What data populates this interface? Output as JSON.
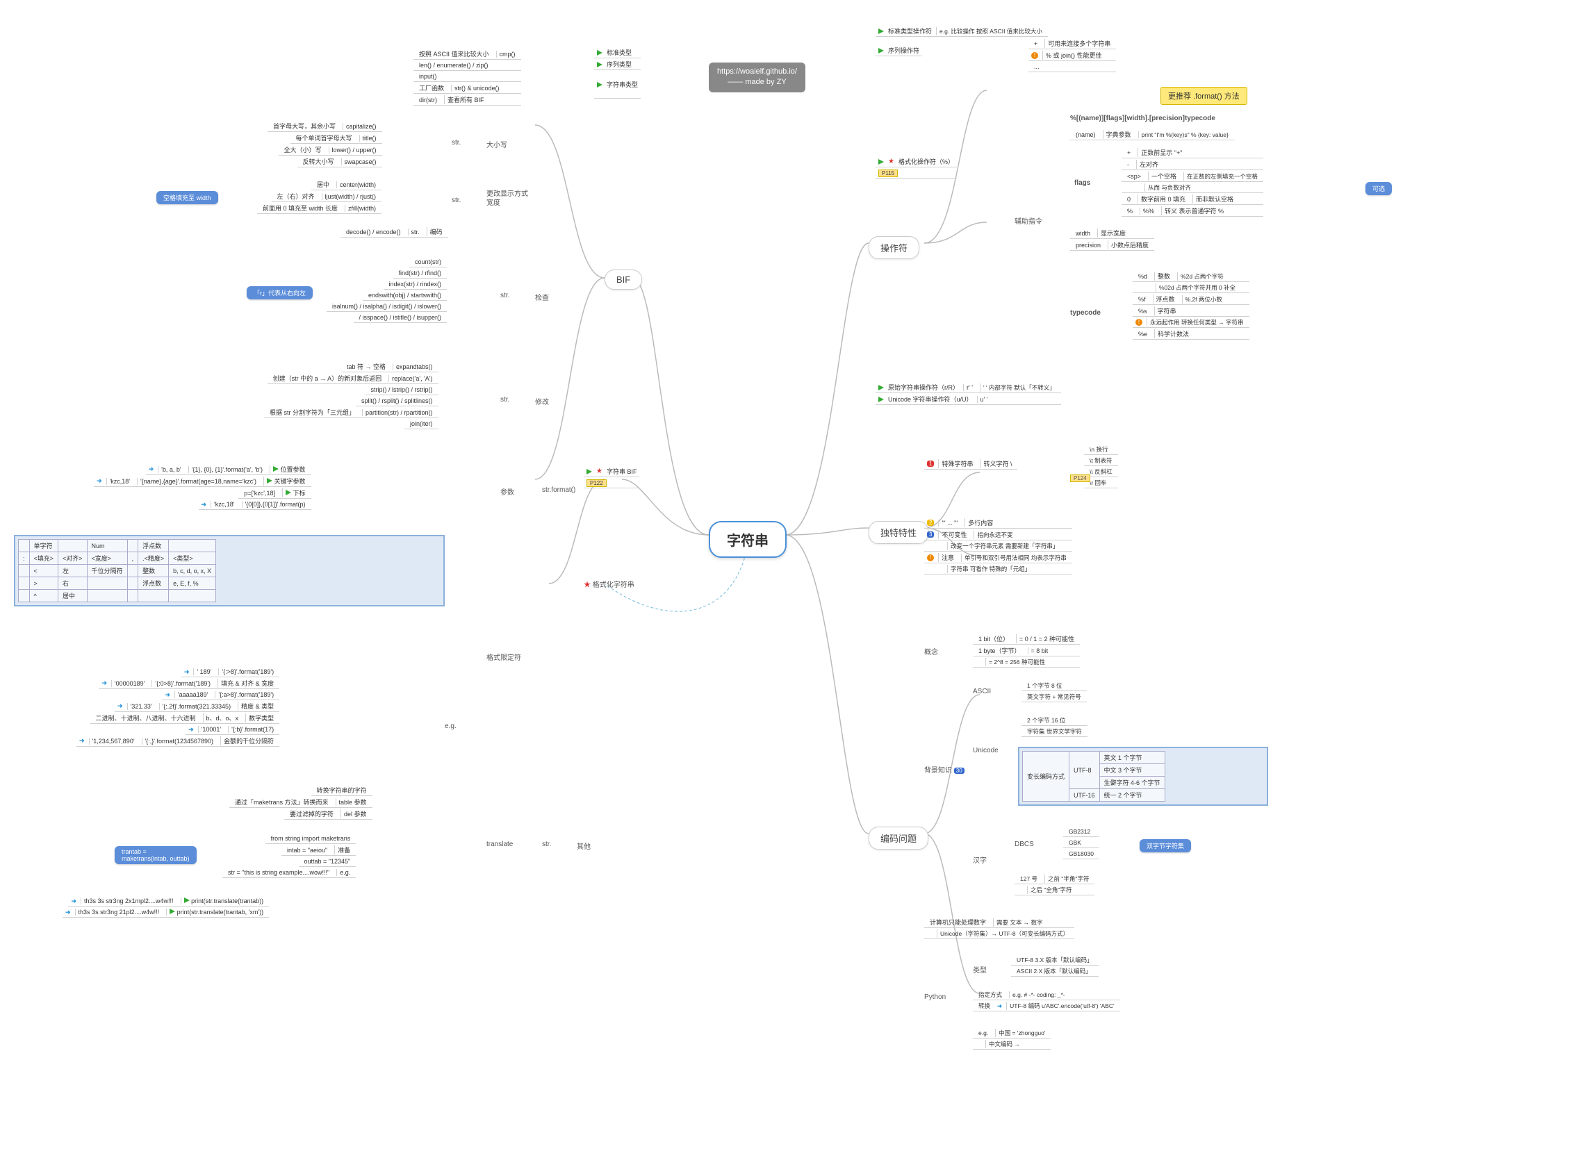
{
  "credit": {
    "url": "https://woaielf.github.io/",
    "by": "—— made by ZY"
  },
  "root": "字符串",
  "main": {
    "bif": "BIF",
    "ops": "操作符",
    "feats": "独特特性",
    "enc": "编码问题"
  },
  "sec": {
    "str1": "str.",
    "daxiao": "大小写",
    "change": "更改显示方式",
    "width": "宽度",
    "enc2": "编码",
    "str2": "str.",
    "check": "检查",
    "str3": "str.",
    "mod": "修改",
    "strbif": "字符串 BIF",
    "p122": "P122",
    "fmt": "str.format()",
    "params": "参数",
    "fmtcls": "格式化字符串",
    "fmtspec": "格式限定符",
    "eg": "e.g.",
    "eg2": "e.g.",
    "table": "table 参数",
    "del": "del 参数",
    "prep": "准备",
    "translate": "translate",
    "str4": "str.",
    "other": "其他",
    "std": "标准类型",
    "seq": "序列类型",
    "strcls2": "字符串类型",
    "gcmt": "工厂函数",
    "dir": "查看所有 BIF",
    "aux": "辅助指令",
    "flags": "flags",
    "width2": "width",
    "prec": "precision",
    "type": "typecode",
    "concept": "概念",
    "bg": "背景知识",
    "ascii": "ASCII",
    "unicode": "Unicode",
    "hanzi": "汉字",
    "dbcs": "DBCS",
    "python": "Python",
    "kind": "类型",
    "p115": "P115",
    "p124": "P124",
    "num30": "30",
    "posarg": "位置参数",
    "kwarg": "关键字参数",
    "subscript": "下标",
    "fillwidth": "填充 & 对齐 & 宽度",
    "prectype": "精度 & 类型",
    "numtype": "数字类型",
    "thousep": "金额的千位分隔符",
    "varenc": "变长编码方式",
    "utf8": "UTF-8",
    "utf16": "UTF-16",
    "spec": "指定方式",
    "conv": "转换"
  },
  "txt": {
    "cap": "capitalize()",
    "capdesc": "首字母大写，其余小写",
    "title": "title()",
    "titledesc": "每个单词首字母大写",
    "lu": "lower() / upper()",
    "ludesc": "全大（小）写",
    "swap": "swapcase()",
    "swapdesc": "反转大小写",
    "center": "center(width)",
    "centerdesc": "居中",
    "lrjust": "ljust(width) / rjust()",
    "lrjustdesc": "左（右）对齐",
    "zfill": "zfill(width)",
    "zfilldesc": "前面用 0 填充至 width 长度",
    "deenc": "decode() / encode()",
    "count": "count(str)",
    "find": "find(str) / rfind()",
    "index": "index(str) / rindex()",
    "endsw": "endswith(obj) / startswith()",
    "isal": "isalnum() / isalpha() / isdigit() / islower()",
    "isal2": "/ isspace() / istitle() / isupper()",
    "expand": "expandtabs()",
    "expanddesc": "tab 符 → 空格",
    "replace": "replace('a', 'A')",
    "replacedesc": "创建（str 中的 a → A）的新对象后返回",
    "strip": "strip() / lstrip() / rstrip()",
    "split": "split() / rsplit() / splitlines()",
    "part": "partition(str) / rpartition()",
    "partdesc": "根据 str 分割字符为「三元组」",
    "join": "join(iter)",
    "cmp": "cmp()",
    "cmpdesc": "按照 ASCII 值来比较大小",
    "lenenum": "len() / enumerate() / zip()",
    "input": "input()",
    "struni": "str() & unicode()",
    "dirstr": "dir(str)",
    "posa": "'b, a, b'",
    "posb": "'{1}, {0}, {1}'.format('a', 'b')",
    "kwa": "'kzc,18'",
    "kwb": "'{name},{age}'.format(age=18,name='kzc')",
    "suba": "'kzc,18'",
    "subb": "'{0[0]},{0[1]}'.format(p)",
    "subp": "p=['kzc',18]",
    "fill1a": "' 189'",
    "fill1b": "'{:>8}'.format('189')",
    "fill2a": "'00000189'",
    "fill2b": "'{:0>8}'.format('189')",
    "fill3a": "'aaaaa189'",
    "fill3b": "'{:a>8}'.format('189')",
    "prec1a": "'321.33'",
    "prec1b": "'{:.2f}'.format(321.33345)",
    "numlbl": "二进制、十进制、八进制、十六进制",
    "numfmt": "b、d、o、x",
    "num1a": "'10001'",
    "num1b": "'{:b}'.format(17)",
    "th1a": "'1,234,567,890'",
    "th1b": "'{:,}'.format(1234567890)",
    "trans1": "转换字符串的字符",
    "trans2": "通过「maketrans 方法」转换而来",
    "trans3": "要过滤掉的字符",
    "imp": "from string import maketrans",
    "intab": "intab = \"aeiou\"",
    "outtab": "outtab = \"12345\"",
    "strex": "str = \"this is string example....wow!!!\"",
    "res1a": "th3s 3s str3ng 2x1mpl2....w4w!!!",
    "res1b": "print(str.translate(trantab))",
    "res2a": "th3s 3s str3ng 21pl2....w4w!!!",
    "res2b": "print(str.translate(trantab, 'xm'))",
    "stdop": "标准类型操作符",
    "stdeg": "e.g.    比较操作    按照 ASCII 值来比较大小",
    "seqop": "序列操作符",
    "seq1": "+",
    "seq1d": "可用来连接多个字符串",
    "seq2": "% 或 join() 性能更佳",
    "seq3": "...",
    "fmtop": "格式化操作符（%）",
    "recfmt": "更推荐 .format() 方法",
    "fmtsyn": "%[(name)][flags][width].[precision]typecode",
    "fname": "(name)",
    "fnamed": "字典参数",
    "fnameeg": "print \"I'm %(key)s\" % {key: value}",
    "fplus": "+",
    "fplusd": "正数前显示 \"+\"",
    "fminus": "-",
    "fminusd": "左对齐",
    "fsp": "<sp>",
    "fspd": "一个空格",
    "fspd2": "在正数的左侧填充一个空格",
    "fspd3": "从而    与负数对齐",
    "fzero": "0",
    "fzerod": "数字前用 0 填充",
    "fzerod2": "而非默认空格",
    "fpct": "%",
    "fpct2": "%%",
    "fpctd": "转义    表示普通字符 %",
    "fwidth": "显示宽度",
    "fprec": "小数点后精度",
    "tcd": "%d",
    "tcdd": "整数",
    "tcd1": "%2d    占两个字符",
    "tcd2": "%02d    占两个字符并用 0 补全",
    "tcf": "%f",
    "tcfd": "浮点数",
    "tcf1": "%.2f    两位小数",
    "tcs": "%s",
    "tcsd": "字符串",
    "tcs1": "永远起作用    转换任何类型 → 字符串",
    "tce": "%e",
    "tced": "科学计数法",
    "rawop": "原始字符串操作符（r/R）",
    "rawq": "r' '",
    "rawd": "' ' 内部字符    默认「不转义」",
    "uniop": "Unicode 字符串操作符（u/U）",
    "uniq": "u' '",
    "spec_esc": "特殊字符串",
    "esc": "转义字符 \\",
    "esc_n": "\\n    换行",
    "esc_t": "\\t    制表符",
    "esc_bs": "\\\\    反斜杠",
    "esc_r": "\\r    回车",
    "multi": "多行内容",
    "multis": "''' ... '''",
    "immut": "不可变性",
    "immut1": "指向永远不变",
    "immut2": "改变一个字符串元素    需要新建「字符串」",
    "note": "注意",
    "note1": "单引号和双引号用法相同    均表示字符串",
    "note2": "字符串    可看作    特殊的「元组」",
    "bit": "1 bit（位）",
    "bit1": "= 0 / 1 = 2 种可能性",
    "byte": "1 byte（字节）",
    "byte1": "= 8 bit",
    "byte2": "= 2^8 = 256 种可能性",
    "asc1": "1 个字节    8 位",
    "asc2": "英文字符 + 常见符号",
    "uni1": "2 个字节    16 位",
    "uni2": "字符集    世界文学字符",
    "u8_en": "英文    1 个字节",
    "u8_cn": "中文    3 个字节",
    "u8_rare": "生僻字符    4-6 个字节",
    "u16": "统一    2 个字节",
    "gb1": "GB2312",
    "gb2": "GBK",
    "gb3": "GB18030",
    "dbyte": "双字节字符集",
    "127a": "127 号",
    "127b": "之前    \"半角\"字符",
    "127c": "之后    \"全角\"字符",
    "comp": "计算机只能处理数字",
    "comp1": "需要    文本 → 数字",
    "comp2": "Unicode（字符集）→ UTF-8（可变长编码方式）",
    "py_u8": "UTF-8    3.X 版本「默认编码」",
    "py_asc": "ASCII    2.X 版本「默认编码」",
    "spec_eg": "e.g.    # -*- coding: _*-",
    "conv_eg": "UTF-8 编码    u'ABC'.encode('utf-8')    'ABC'",
    "cn1": "中国 = 'zhongguo'",
    "cn2": "中文编码 →",
    "keixuan": "可选",
    "wpad": "空格填充至 width",
    "rmean": "「r」代表从右向左",
    "trantab": "trantab =\nmaketrans(intab, outtab)"
  },
  "fmtspec_table": {
    "h": [
      "单字符",
      "",
      "Num",
      "浮点数",
      "",
      ""
    ],
    "r1": [
      ":",
      "<填充>",
      "<对齐>",
      "<宽度>",
      ",",
      ".<精度>",
      "<类型>"
    ],
    "a": [
      "<",
      "左",
      "千位分隔符",
      "整数",
      "b, c, d, o, x, X"
    ],
    "b": [
      ">",
      "右",
      "",
      "浮点数",
      "e, E, f, %"
    ],
    "c": [
      "^",
      "居中",
      "",
      "",
      ""
    ]
  }
}
